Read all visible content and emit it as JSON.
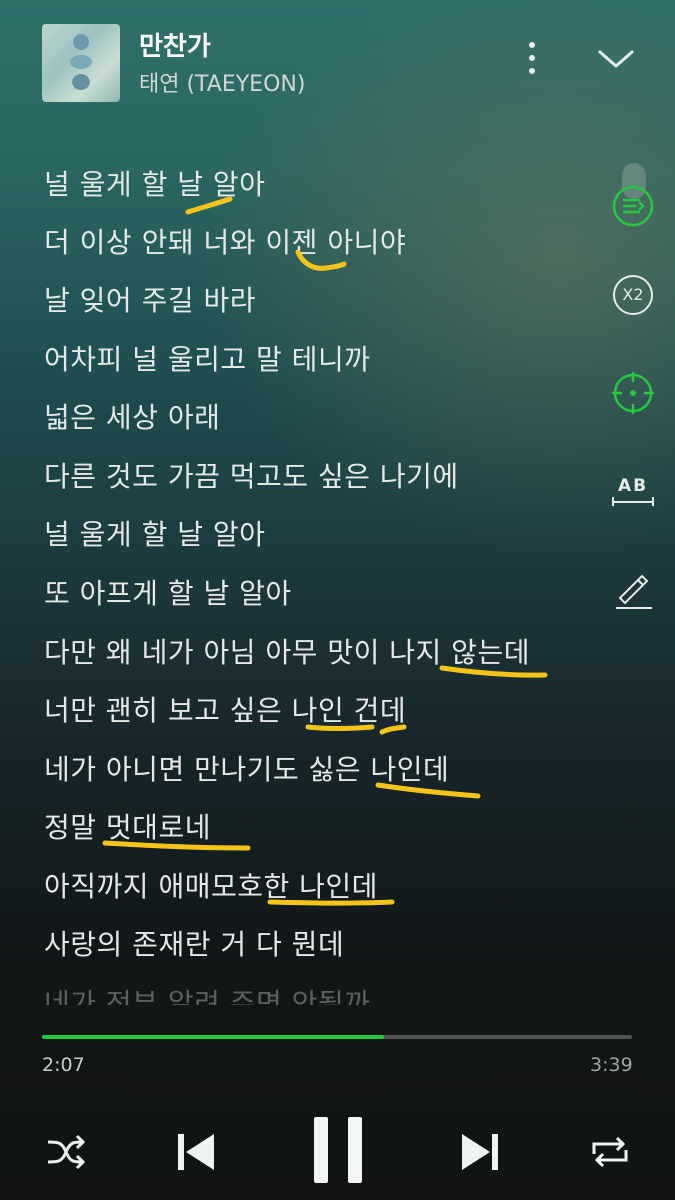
{
  "track": {
    "title": "만찬가",
    "artist": "태연 (TAEYEON)"
  },
  "lyrics": [
    "널 울게 할 날 알아",
    "더 이상 안돼 너와 이젠 아니야",
    "날 잊어 주길 바라",
    "어차피 널 울리고 말 테니까",
    "넓은 세상 아래",
    "다른 것도 가끔 먹고도 싶은 나기에",
    "널 울게 할 날 알아",
    "또 아프게 할 날 알아",
    "다만 왜 네가 아님 아무 맛이 나지 않는데",
    "너만 괜히 보고 싶은 나인 건데",
    "네가 아니면 만나기도 싫은 나인데",
    "정말 멋대로네",
    "아직까지 애매모호한 나인데",
    "사랑의 존재란 거 다 뭔데",
    "네가 전부 알려 주면 안될까"
  ],
  "side_buttons": {
    "speed_label": "X2",
    "translate_label": "AB"
  },
  "icons": [
    "more-vertical-icon",
    "chevron-down-icon",
    "playlist-icon",
    "speed-icon",
    "focus-icon",
    "translate-icon",
    "edit-icon",
    "shuffle-icon",
    "previous-icon",
    "pause-icon",
    "next-icon",
    "repeat-icon"
  ],
  "playback": {
    "elapsed": "2:07",
    "total": "3:39",
    "progress_fraction": 0.58
  },
  "colors": {
    "accent": "#25c93d",
    "highlight": "#f4c518"
  }
}
